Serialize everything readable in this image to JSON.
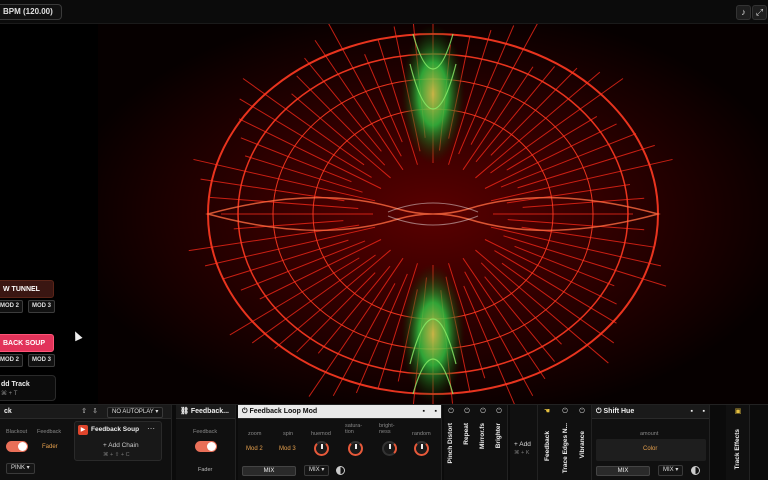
{
  "topbar": {
    "bpm_label": "BPM (120.00)",
    "icons": [
      "music-note-icon",
      "expand-icon"
    ]
  },
  "left_strip": {
    "scenes": [
      {
        "label": "W TUNNEL",
        "mods": [
          "MOD 2",
          "MOD 3"
        ]
      },
      {
        "label": "BACK SOUP",
        "mods": [
          "MOD 2",
          "MOD 3"
        ]
      }
    ],
    "add_track": {
      "label": "dd Track",
      "shortcut": "⌘ + T"
    }
  },
  "bottom": {
    "track_panel": {
      "title": "ck",
      "autoplay": "NO AUTOPLAY ▾",
      "blackout_label": "Blackout",
      "feedback_label": "Feedback",
      "fader_label": "Fader",
      "color_chip": "PINK ▾",
      "chain_title": "Feedback Soup",
      "add_chain_label": "+ Add Chain",
      "add_chain_shortcut": "⌘ + ⇧ + C"
    },
    "feedback_panel": {
      "title": "Feedback...",
      "feedback_label": "Feedback",
      "fader_label": "Fader"
    },
    "loop_mod": {
      "title": "Feedback Loop Mod",
      "params": [
        {
          "name": "zoom",
          "value": "Mod 2"
        },
        {
          "name": "spin",
          "value": "Mod 3"
        },
        {
          "name": "huemod",
          "value": ""
        },
        {
          "name": "satura-tion",
          "value": ""
        },
        {
          "name": "bright-ness",
          "value": ""
        },
        {
          "name": "random",
          "value": ""
        }
      ],
      "mix_label": "MIX",
      "mix_chip": "MIX ▾"
    },
    "effects": [
      "Pinch Distort",
      "Repeat",
      "Mirror.fs",
      "Brighter"
    ],
    "add_effect": {
      "label": "+ Add",
      "shortcut": "⌘ + K"
    },
    "track_effects_vert": [
      "Feedback",
      "Trace Edges N...",
      "Vibrance"
    ],
    "shift_hue": {
      "title": "Shift Hue",
      "amount_label": "amount",
      "amount_value": "Color",
      "mix_label": "MIX",
      "mix_chip": "MIX ▾"
    },
    "track_effects_label": "Track Effects"
  },
  "colors": {
    "accent": "#e96f58",
    "scene_active": "#e2335a",
    "value_text": "#e6a04d"
  }
}
